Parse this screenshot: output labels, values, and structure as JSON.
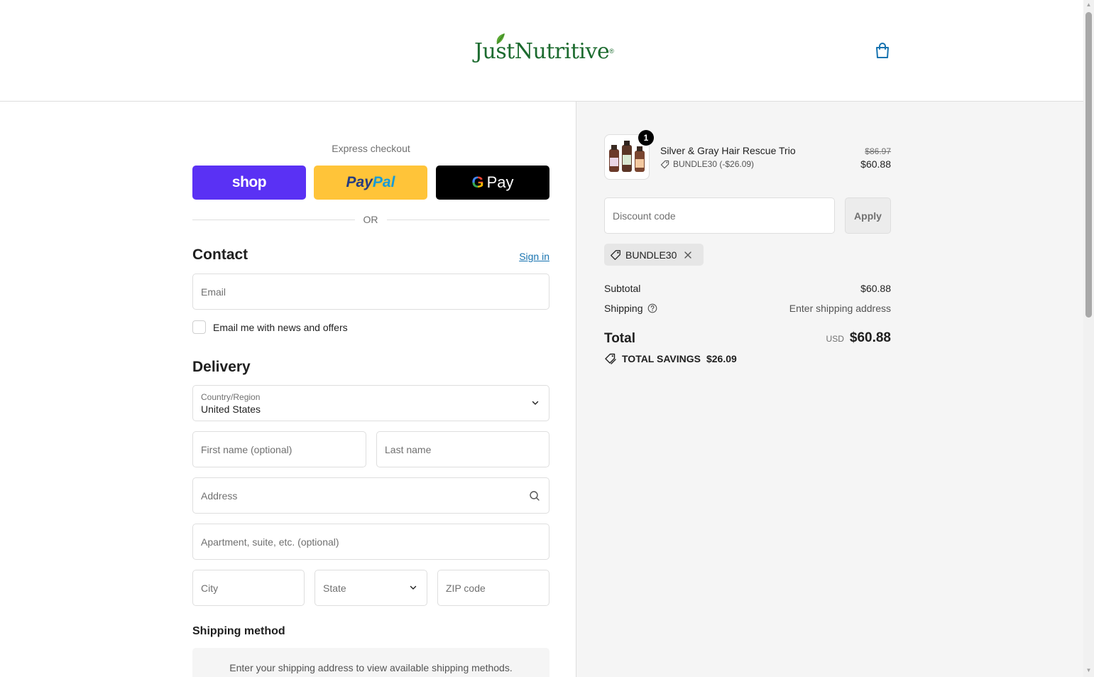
{
  "header": {
    "brand": "JustNutritive",
    "brand_mark": "®",
    "cart_icon": "shopping-bag-icon"
  },
  "express": {
    "label": "Express checkout",
    "shop_label": "shop",
    "paypal_label_1": "Pay",
    "paypal_label_2": "Pal",
    "gpay_g": "G",
    "gpay_label": "Pay",
    "or_label": "OR",
    "colors": {
      "shop": "#5a31f4",
      "paypal": "#ffc439",
      "gpay": "#000000"
    }
  },
  "contact": {
    "title": "Contact",
    "sign_in": "Sign in",
    "email_placeholder": "Email",
    "newsletter_label": "Email me with news and offers"
  },
  "delivery": {
    "title": "Delivery",
    "country_label": "Country/Region",
    "country_value": "United States",
    "first_name_placeholder": "First name (optional)",
    "last_name_placeholder": "Last name",
    "address_placeholder": "Address",
    "apartment_placeholder": "Apartment, suite, etc. (optional)",
    "city_placeholder": "City",
    "state_placeholder": "State",
    "zip_placeholder": "ZIP code"
  },
  "shipping_method": {
    "title": "Shipping method",
    "message": "Enter your shipping address to view available shipping methods."
  },
  "summary": {
    "product": {
      "name": "Silver & Gray Hair Rescue Trio",
      "quantity": "1",
      "discount_line": "BUNDLE30 (-$26.09)",
      "old_price": "$86.97",
      "price": "$60.88"
    },
    "discount_placeholder": "Discount code",
    "apply_label": "Apply",
    "applied_code": "BUNDLE30",
    "subtotal_label": "Subtotal",
    "subtotal_value": "$60.88",
    "shipping_label": "Shipping",
    "shipping_value": "Enter shipping address",
    "total_label": "Total",
    "currency": "USD",
    "total_value": "$60.88",
    "savings_label": "TOTAL SAVINGS",
    "savings_value": "$26.09"
  },
  "theme": {
    "link_color": "#1773b0",
    "brand_green": "#1c6b2f",
    "summary_bg": "#f5f5f5"
  }
}
